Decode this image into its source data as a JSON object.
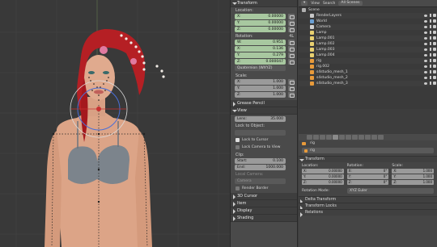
{
  "npanel": {
    "transform_header": "Transform",
    "location_label": "Location:",
    "location": [
      {
        "axis": "X:",
        "value": "0.00000"
      },
      {
        "axis": "Y:",
        "value": "0.00000"
      },
      {
        "axis": "Z:",
        "value": "0.00000"
      }
    ],
    "rotation_label": "Rotation:",
    "rotation_mode_tag": "4L",
    "rotation": [
      {
        "axis": "W:",
        "value": "0.951"
      },
      {
        "axis": "X:",
        "value": "0.136"
      },
      {
        "axis": "Y:",
        "value": "0.279"
      },
      {
        "axis": "Z:",
        "value": "0.000047"
      }
    ],
    "rotation_mode": "Quaternion (WXYZ)",
    "scale_label": "Scale:",
    "scale": [
      {
        "axis": "X:",
        "value": "1.000"
      },
      {
        "axis": "Y:",
        "value": "1.000"
      },
      {
        "axis": "Z:",
        "value": "1.000"
      }
    ],
    "grease_pencil_header": "Grease Pencil",
    "view_header": "View",
    "lens_label": "Lens:",
    "lens_value": "35.000",
    "lock_to_object_label": "Lock to Object:",
    "lock_to_cursor": "Lock to Cursor",
    "lock_camera_to_view": "Lock Camera to View",
    "clip_label": "Clip:",
    "clip_start_label": "Start:",
    "clip_start_value": "0.100",
    "clip_end_label": "End:",
    "clip_end_value": "1000.000",
    "local_camera_label": "Local Camera:",
    "camera_value": "Camera",
    "render_border": "Render Border",
    "cursor_3d_header": "3D Cursor",
    "item_header": "Item",
    "display_header": "Display",
    "shading_header": "Shading"
  },
  "outliner": {
    "view_menu": "View",
    "search_menu": "Search",
    "filter": "All Scenes",
    "rows": [
      {
        "name": "Scene",
        "indent": 0,
        "icon_color": "#b0b0b0"
      },
      {
        "name": "RenderLayers",
        "indent": 1,
        "icon_color": "#c8c8c8"
      },
      {
        "name": "World",
        "indent": 1,
        "icon_color": "#6a9fd4"
      },
      {
        "name": "Camera",
        "indent": 1,
        "icon_color": "#d0d0d0"
      },
      {
        "name": "Lamp",
        "indent": 1,
        "icon_color": "#e8d070"
      },
      {
        "name": "Lamp.001",
        "indent": 1,
        "icon_color": "#e8d070"
      },
      {
        "name": "Lamp.002",
        "indent": 1,
        "icon_color": "#e8d070"
      },
      {
        "name": "Lamp.003",
        "indent": 1,
        "icon_color": "#e8d070"
      },
      {
        "name": "Lamp.004",
        "indent": 1,
        "icon_color": "#e8d070"
      },
      {
        "name": "rig",
        "indent": 1,
        "icon_color": "#e89a3a"
      },
      {
        "name": "rig.002",
        "indent": 1,
        "icon_color": "#e89a3a"
      },
      {
        "name": "s4studio_mesh_1",
        "indent": 1,
        "icon_color": "#e89a3a"
      },
      {
        "name": "s4studio_mesh_2",
        "indent": 1,
        "icon_color": "#e89a3a"
      },
      {
        "name": "s4studio_mesh_3",
        "indent": 1,
        "icon_color": "#e89a3a"
      }
    ]
  },
  "props": {
    "context_path": "rig",
    "object_name": "rig",
    "transform_header": "Transform",
    "location_label": "Location:",
    "rotation_label": "Rotation:",
    "scale_label": "Scale:",
    "location": [
      {
        "axis": "X:",
        "value": "0.00000"
      },
      {
        "axis": "Y:",
        "value": "0.00000"
      },
      {
        "axis": "Z:",
        "value": "0.00000"
      }
    ],
    "rotation": [
      {
        "axis": "X:",
        "value": "0°"
      },
      {
        "axis": "Y:",
        "value": "0°"
      },
      {
        "axis": "Z:",
        "value": "0°"
      }
    ],
    "scale": [
      {
        "axis": "X:",
        "value": "1.000"
      },
      {
        "axis": "Y:",
        "value": "1.000"
      },
      {
        "axis": "Z:",
        "value": "1.000"
      }
    ],
    "rotation_mode_label": "Rotation Mode:",
    "rotation_mode_value": "XYZ Euler",
    "delta_transform": "Delta Transform",
    "transform_locks": "Transform Locks",
    "relations": "Relations"
  }
}
